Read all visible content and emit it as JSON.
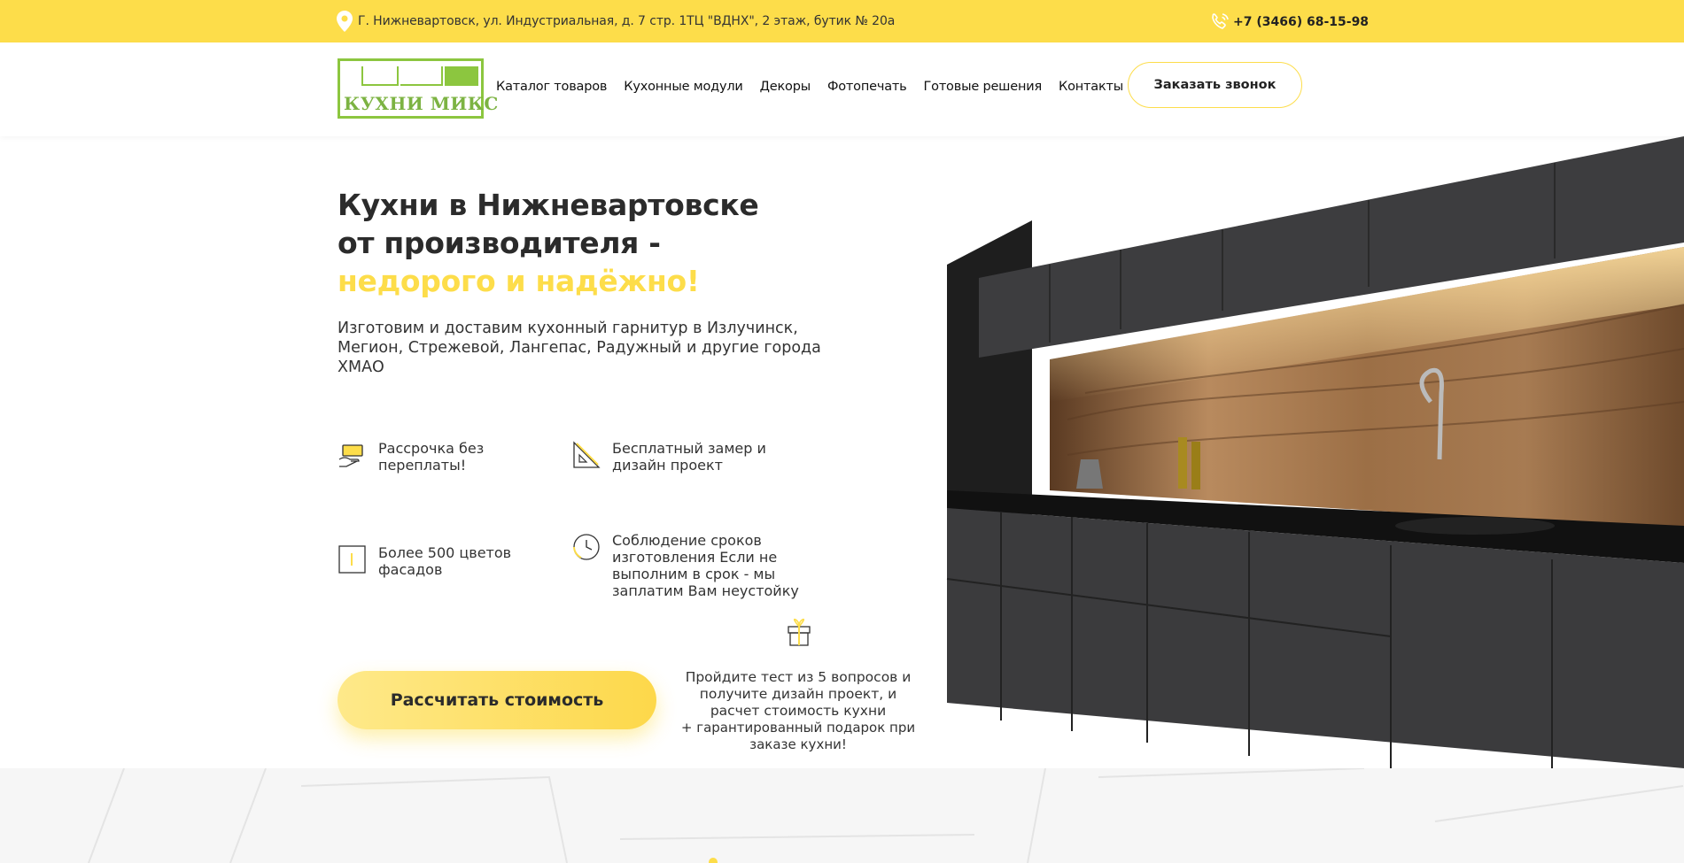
{
  "topbar": {
    "address": "Г. Нижневартовск, ул. Индустриальная, д. 7 стр. 1ТЦ \"ВДНХ\", 2 этаж, бутик № 20а",
    "phone": "+7 (3466) 68-15-98",
    "bg_color": "#fddd4a",
    "address_icon": "location-pin-icon",
    "phone_icon": "phone-icon"
  },
  "header": {
    "logo_text": "КУХНИ МИКС",
    "nav": [
      {
        "label": "Каталог товаров"
      },
      {
        "label": "Кухонные модули"
      },
      {
        "label": "Декоры"
      },
      {
        "label": "Фотопечать"
      },
      {
        "label": "Готовые решения"
      },
      {
        "label": "Контакты"
      }
    ],
    "call_button": "Заказать звонок"
  },
  "hero": {
    "title_line1": "Кухни в Нижневартовске",
    "title_line2": "от производителя -",
    "title_accent": "недорого и надёжно!",
    "subtitle": "Изготовим и доставим кухонный гарнитур в Излучинск, Мегион, Стрежевой, Лангепас, Радужный и другие города ХМАО",
    "features": [
      {
        "icon": "money-hand-icon",
        "text": "Рассрочка без переплаты!"
      },
      {
        "icon": "ruler-triangle-icon",
        "text": "Бесплатный замер и дизайн проект"
      },
      {
        "icon": "palette-door-icon",
        "text": "Более 500 цветов фасадов"
      },
      {
        "icon": "clock-icon",
        "text": "Соблюдение сроков изготовления Если не выполним в срок - мы заплатим Вам неустойку"
      }
    ],
    "cta_button": "Рассчитать стоимость",
    "promo_text": "Пройдите тест из 5 вопросов и получите дизайн проект, и расчет стоимость кухни",
    "promo_gift": "+ гарантированный подарок при заказе кухни!",
    "gift_icon": "gift-icon",
    "accent_color": "#fddd4a"
  }
}
